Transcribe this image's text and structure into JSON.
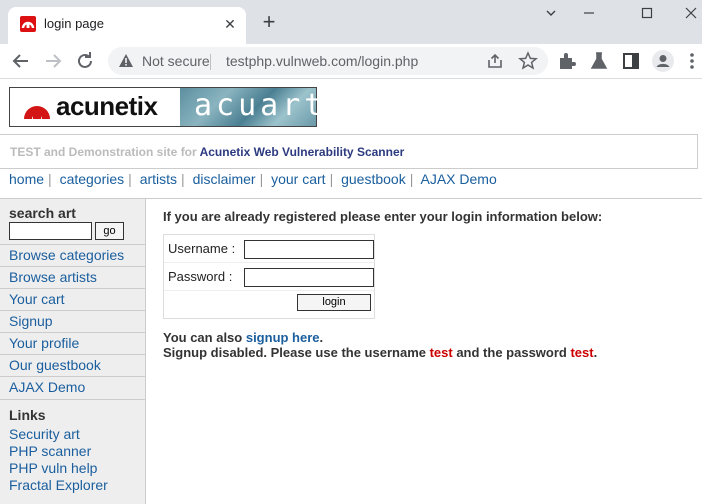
{
  "browser": {
    "tab_title": "login page",
    "url_security": "Not secure",
    "url": "testphp.vulnweb.com/login.php"
  },
  "header": {
    "logo_left": "acunetix",
    "logo_right": "acuart",
    "tagline_prefix": "TEST and Demonstration site for ",
    "tagline_link": "Acunetix Web Vulnerability Scanner"
  },
  "topnav": [
    "home",
    "categories",
    "artists",
    "disclaimer",
    "your cart",
    "guestbook",
    "AJAX Demo"
  ],
  "sidebar": {
    "search_label": "search art",
    "search_value": "",
    "go_label": "go",
    "links": [
      "Browse categories",
      "Browse artists",
      "Your cart",
      "Signup",
      "Your profile",
      "Our guestbook",
      "AJAX Demo"
    ],
    "links_heading": "Links",
    "external_links": [
      "Security art",
      "PHP scanner",
      "PHP vuln help",
      "Fractal Explorer"
    ]
  },
  "main": {
    "heading": "If you are already registered please enter your login information below:",
    "username_label": "Username :",
    "password_label": "Password :",
    "username_value": "",
    "password_value": "",
    "login_button": "login",
    "note_prefix": "You can also ",
    "note_link": "signup here",
    "note_suffix": ".",
    "signup_text_a": "Signup disabled. Please use the username ",
    "signup_user": "test",
    "signup_text_b": " and the password ",
    "signup_pass": "test",
    "signup_text_c": "."
  },
  "colors": {
    "link": "#1a5e9e",
    "accent_red": "#cc0000",
    "sidebar_bg": "#eeeeee"
  }
}
